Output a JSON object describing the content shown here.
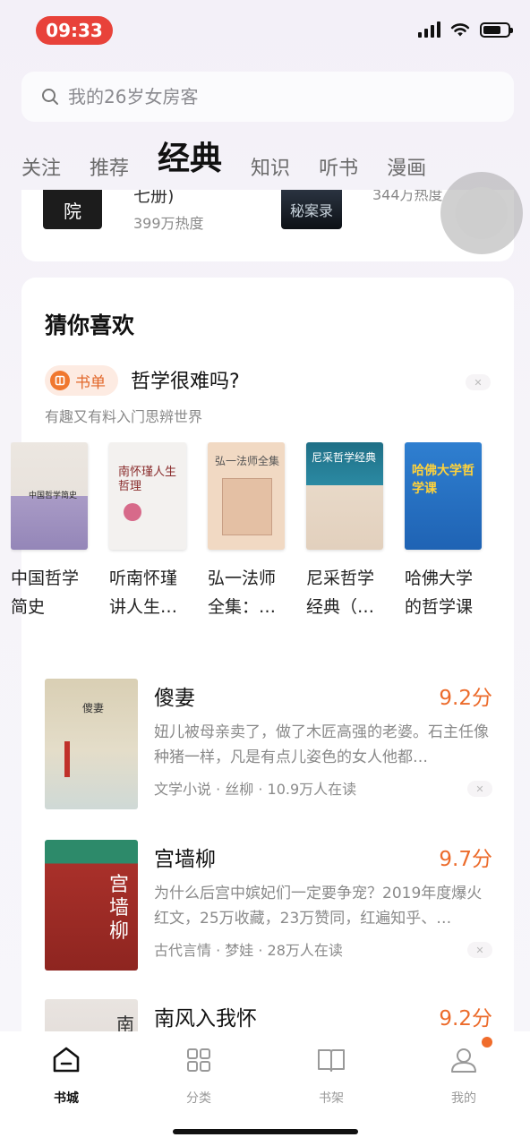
{
  "status_bar": {
    "time": "09:33"
  },
  "search": {
    "placeholder": "我的26岁女房客"
  },
  "tabs": [
    {
      "label": "关注",
      "active": false
    },
    {
      "label": "推荐",
      "active": false
    },
    {
      "label": "经典",
      "active": true
    },
    {
      "label": "知识",
      "active": false
    },
    {
      "label": "听书",
      "active": false
    },
    {
      "label": "漫画",
      "active": false
    }
  ],
  "prev_card": {
    "book1_title_cut": "七册)",
    "book1_cover_text": "院",
    "book1_heat": "399万热度",
    "book2_cover_text": "秘案录",
    "book2_heat_cut": "344万热度"
  },
  "guess": {
    "title": "猜你喜欢",
    "booklist_badge": "书单",
    "booklist_title": "哲学很难吗?",
    "booklist_subtitle": "有趣又有料入门思辨世界",
    "books": [
      {
        "title": "中国哲学简史",
        "cover_text": "中国哲学简史"
      },
      {
        "title": "听南怀瑾讲人生…",
        "cover_text": "南怀瑾人生哲理"
      },
      {
        "title": "弘一法师全集：…",
        "cover_text": "弘一法师全集"
      },
      {
        "title": "尼采哲学经典（…",
        "cover_text": "尼采哲学经典"
      },
      {
        "title": "哈佛大学的哲学课",
        "cover_text": "哈佛大学哲学课"
      }
    ],
    "list": [
      {
        "name": "傻妻",
        "score": "9.2分",
        "desc": "妞儿被母亲卖了，做了木匠高强的老婆。石主任像种猪一样，凡是有点儿姿色的女人他都…",
        "meta": "文学小说 · 丝柳 · 10.9万人在读",
        "cover_text": "傻妻"
      },
      {
        "name": "宫墙柳",
        "score": "9.7分",
        "desc": "为什么后宫中嫔妃们一定要争宠？2019年度爆火红文，25万收藏，23万赞同，红遍知乎、…",
        "meta": "古代言情 · 梦娃 · 28万人在读",
        "cover_text": "宫墙柳"
      },
      {
        "name": "南风入我怀",
        "score": "9.2分",
        "desc": "",
        "meta": "",
        "cover_text": "南"
      }
    ]
  },
  "bottom_nav": [
    {
      "label": "书城",
      "icon": "home-icon",
      "active": true
    },
    {
      "label": "分类",
      "icon": "grid-icon",
      "active": false
    },
    {
      "label": "书架",
      "icon": "book-icon",
      "active": false
    },
    {
      "label": "我的",
      "icon": "user-icon",
      "active": false
    }
  ],
  "colors": {
    "accent": "#ec6b2b",
    "time_pill": "#e8423a"
  }
}
